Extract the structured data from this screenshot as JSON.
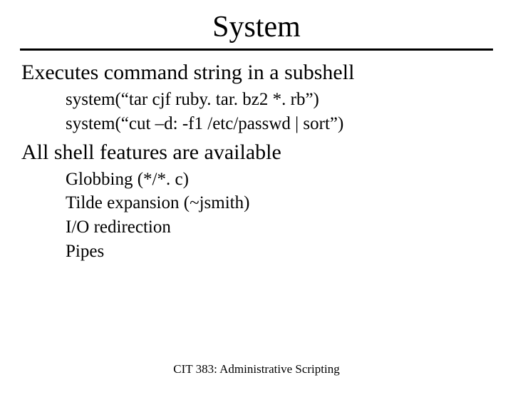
{
  "title": "System",
  "section1": {
    "heading": "Executes command string in a subshell",
    "line1": "system(“tar cjf ruby. tar. bz2 *. rb”)",
    "line2": "system(“cut –d: -f1 /etc/passwd | sort”)"
  },
  "section2": {
    "heading": "All shell features are available",
    "line1": "Globbing (*/*. c)",
    "line2": "Tilde expansion (~jsmith)",
    "line3": "I/O redirection",
    "line4": "Pipes"
  },
  "footer": "CIT 383: Administrative Scripting"
}
